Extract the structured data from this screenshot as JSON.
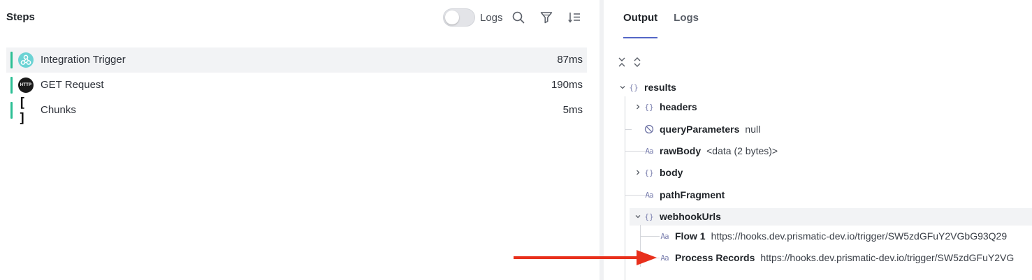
{
  "left_panel": {
    "title": "Steps",
    "toolbar": {
      "logs_toggle_label": "Logs",
      "logs_toggle_on": false
    },
    "steps": [
      {
        "label": "Integration Trigger",
        "duration": "87ms",
        "icon": "webhook-icon",
        "status_color": "#2bbf94"
      },
      {
        "label": "GET Request",
        "duration": "190ms",
        "icon": "http-icon",
        "icon_text": "HTTP",
        "status_color": "#2bbf94"
      },
      {
        "label": "Chunks",
        "duration": "5ms",
        "icon": "brackets-icon",
        "icon_text": "[ ]",
        "status_color": "#2bbf94"
      }
    ]
  },
  "right_panel": {
    "tabs": [
      {
        "label": "Output",
        "active": true
      },
      {
        "label": "Logs",
        "active": false
      }
    ],
    "tree": {
      "root": {
        "key": "results",
        "type": "object",
        "expanded": true
      },
      "children": [
        {
          "key": "headers",
          "type": "object",
          "value": ""
        },
        {
          "key": "queryParameters",
          "type": "null",
          "value": "null"
        },
        {
          "key": "rawBody",
          "type": "string",
          "value": "<data (2 bytes)>"
        },
        {
          "key": "body",
          "type": "object",
          "value": ""
        },
        {
          "key": "pathFragment",
          "type": "string",
          "value": ""
        },
        {
          "key": "webhookUrls",
          "type": "object",
          "value": ""
        }
      ],
      "webhook_children": [
        {
          "key": "Flow 1",
          "type": "string",
          "value": "https://hooks.dev.prismatic-dev.io/trigger/SW5zdGFuY2VGbG93Q29"
        },
        {
          "key": "Process Records",
          "type": "string",
          "value": "https://hooks.dev.prismatic-dev.io/trigger/SW5zdGFuY2VG"
        }
      ],
      "type_glyphs": {
        "object": "{}",
        "string": "Aa",
        "null": "⦸"
      }
    }
  },
  "colors": {
    "accent": "#5466c7",
    "success": "#2bbf94",
    "annotation_arrow": "#e8301c"
  }
}
